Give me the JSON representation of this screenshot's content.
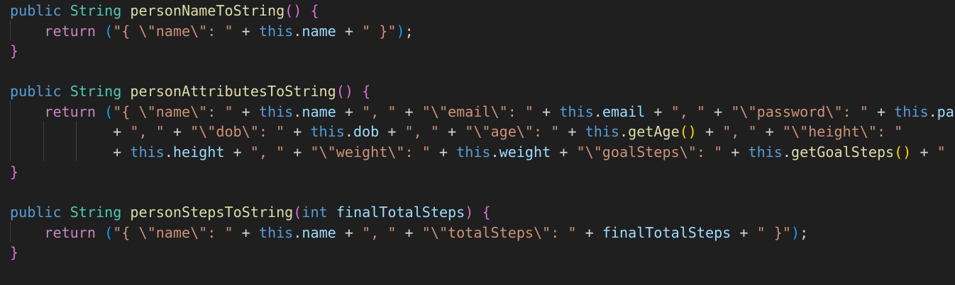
{
  "editor": {
    "language": "java",
    "theme_colors": {
      "background": "#1f1f1f",
      "keyword": "#569cd6",
      "control": "#c586c0",
      "type": "#4ec9b0",
      "function": "#dcdcaa",
      "string": "#ce9178",
      "variable": "#9cdcfe",
      "punctuation": "#d4d4d4",
      "bracket_1": "#ffd700",
      "bracket_2": "#da70d6",
      "bracket_3": "#179fff"
    },
    "lines": [
      [
        [
          "public",
          "kw"
        ],
        [
          " ",
          "pun"
        ],
        [
          "String",
          "typ"
        ],
        [
          " ",
          "pun"
        ],
        [
          "personNameToString",
          "fn"
        ],
        [
          "()",
          "b2"
        ],
        [
          " ",
          "pun"
        ],
        [
          "{",
          "b2"
        ]
      ],
      [
        [
          "    ",
          "pun"
        ],
        [
          "return",
          "ctl"
        ],
        [
          " ",
          "pun"
        ],
        [
          "(",
          "b3"
        ],
        [
          "\"{ \\\"name\\\": \"",
          "str"
        ],
        [
          " + ",
          "pun"
        ],
        [
          "this",
          "kw"
        ],
        [
          ".",
          "pun"
        ],
        [
          "name",
          "prm"
        ],
        [
          " + ",
          "pun"
        ],
        [
          "\" }\"",
          "str"
        ],
        [
          ")",
          "b3"
        ],
        [
          ";",
          "pun"
        ]
      ],
      [
        [
          "}",
          "b2"
        ]
      ],
      [
        [
          "",
          "pun"
        ]
      ],
      [
        [
          "public",
          "kw"
        ],
        [
          " ",
          "pun"
        ],
        [
          "String",
          "typ"
        ],
        [
          " ",
          "pun"
        ],
        [
          "personAttributesToString",
          "fn"
        ],
        [
          "()",
          "b2"
        ],
        [
          " ",
          "pun"
        ],
        [
          "{",
          "b2"
        ]
      ],
      [
        [
          "    ",
          "pun"
        ],
        [
          "return",
          "ctl"
        ],
        [
          " ",
          "pun"
        ],
        [
          "(",
          "b3"
        ],
        [
          "\"{ \\\"name\\\": \"",
          "str"
        ],
        [
          " + ",
          "pun"
        ],
        [
          "this",
          "kw"
        ],
        [
          ".",
          "pun"
        ],
        [
          "name",
          "prm"
        ],
        [
          " + ",
          "pun"
        ],
        [
          "\", \"",
          "str"
        ],
        [
          " + ",
          "pun"
        ],
        [
          "\"\\\"email\\\": \"",
          "str"
        ],
        [
          " + ",
          "pun"
        ],
        [
          "this",
          "kw"
        ],
        [
          ".",
          "pun"
        ],
        [
          "email",
          "prm"
        ],
        [
          " + ",
          "pun"
        ],
        [
          "\", \"",
          "str"
        ],
        [
          " + ",
          "pun"
        ],
        [
          "\"\\\"password\\\": \"",
          "str"
        ],
        [
          " + ",
          "pun"
        ],
        [
          "this",
          "kw"
        ],
        [
          ".",
          "pun"
        ],
        [
          "password",
          "prm"
        ]
      ],
      [
        [
          "            + ",
          "pun"
        ],
        [
          "\", \"",
          "str"
        ],
        [
          " + ",
          "pun"
        ],
        [
          "\"\\\"dob\\\": \"",
          "str"
        ],
        [
          " + ",
          "pun"
        ],
        [
          "this",
          "kw"
        ],
        [
          ".",
          "pun"
        ],
        [
          "dob",
          "prm"
        ],
        [
          " + ",
          "pun"
        ],
        [
          "\", \"",
          "str"
        ],
        [
          " + ",
          "pun"
        ],
        [
          "\"\\\"age\\\": \"",
          "str"
        ],
        [
          " + ",
          "pun"
        ],
        [
          "this",
          "kw"
        ],
        [
          ".",
          "pun"
        ],
        [
          "getAge",
          "fn"
        ],
        [
          "()",
          "b1"
        ],
        [
          " + ",
          "pun"
        ],
        [
          "\", \"",
          "str"
        ],
        [
          " + ",
          "pun"
        ],
        [
          "\"\\\"height\\\": \"",
          "str"
        ]
      ],
      [
        [
          "            + ",
          "pun"
        ],
        [
          "this",
          "kw"
        ],
        [
          ".",
          "pun"
        ],
        [
          "height",
          "prm"
        ],
        [
          " + ",
          "pun"
        ],
        [
          "\", \"",
          "str"
        ],
        [
          " + ",
          "pun"
        ],
        [
          "\"\\\"weight\\\": \"",
          "str"
        ],
        [
          " + ",
          "pun"
        ],
        [
          "this",
          "kw"
        ],
        [
          ".",
          "pun"
        ],
        [
          "weight",
          "prm"
        ],
        [
          " + ",
          "pun"
        ],
        [
          "\"\\\"goalSteps\\\": \"",
          "str"
        ],
        [
          " + ",
          "pun"
        ],
        [
          "this",
          "kw"
        ],
        [
          ".",
          "pun"
        ],
        [
          "getGoalSteps",
          "fn"
        ],
        [
          "()",
          "b1"
        ],
        [
          " + ",
          "pun"
        ],
        [
          "\" }\"",
          "str"
        ],
        [
          ")",
          "b3"
        ],
        [
          ";",
          "pun"
        ]
      ],
      [
        [
          "}",
          "b2"
        ]
      ],
      [
        [
          "",
          "pun"
        ]
      ],
      [
        [
          "public",
          "kw"
        ],
        [
          " ",
          "pun"
        ],
        [
          "String",
          "typ"
        ],
        [
          " ",
          "pun"
        ],
        [
          "personStepsToString",
          "fn"
        ],
        [
          "(",
          "b2"
        ],
        [
          "int",
          "kw"
        ],
        [
          " ",
          "pun"
        ],
        [
          "finalTotalSteps",
          "prm"
        ],
        [
          ")",
          "b2"
        ],
        [
          " ",
          "pun"
        ],
        [
          "{",
          "b2"
        ]
      ],
      [
        [
          "    ",
          "pun"
        ],
        [
          "return",
          "ctl"
        ],
        [
          " ",
          "pun"
        ],
        [
          "(",
          "b3"
        ],
        [
          "\"{ \\\"name\\\": \"",
          "str"
        ],
        [
          " + ",
          "pun"
        ],
        [
          "this",
          "kw"
        ],
        [
          ".",
          "pun"
        ],
        [
          "name",
          "prm"
        ],
        [
          " + ",
          "pun"
        ],
        [
          "\", \"",
          "str"
        ],
        [
          " + ",
          "pun"
        ],
        [
          "\"\\\"totalSteps\\\": \"",
          "str"
        ],
        [
          " + ",
          "pun"
        ],
        [
          "finalTotalSteps",
          "prm"
        ],
        [
          " + ",
          "pun"
        ],
        [
          "\" }\"",
          "str"
        ],
        [
          ")",
          "b3"
        ],
        [
          ";",
          "pun"
        ]
      ],
      [
        [
          "}",
          "b2"
        ]
      ]
    ]
  }
}
